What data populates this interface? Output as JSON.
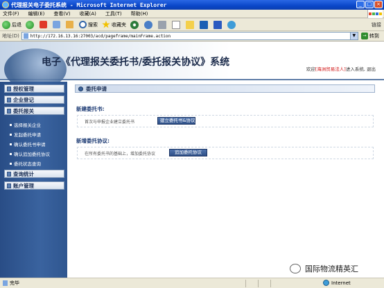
{
  "window": {
    "title": "代理报关电子委托系统 - Microsoft Internet Explorer",
    "min": "_",
    "max": "□",
    "close": "×"
  },
  "menu": [
    "文件(F)",
    "编辑(E)",
    "查看(V)",
    "收藏(A)",
    "工具(T)",
    "帮助(H)"
  ],
  "toolbar": {
    "back": "后退",
    "search": "搜索",
    "favorites": "收藏夹",
    "links": "链接"
  },
  "address": {
    "label": "地址(D)",
    "url": "http://172.16.13.16:27003/acd/pageframe/mainFrame.action",
    "go": "转到"
  },
  "header": {
    "site_title": "电子《代理报关委托书/委托报关协议》系统",
    "welcome": "欢迎",
    "user": "[海洲贸易法人]",
    "entered": "进入系统,",
    "logout": "退出"
  },
  "sidebar": {
    "sections": [
      {
        "label": "授权管理"
      },
      {
        "label": "企业登记"
      },
      {
        "label": "委托报关"
      }
    ],
    "sub_items": [
      "选择报关企业",
      "发起委托申请",
      "确认委托书申请",
      "确认追加委托协议",
      "委托状态查询"
    ],
    "bottom_sections": [
      {
        "label": "查询统计"
      },
      {
        "label": "账户管理"
      }
    ]
  },
  "main": {
    "section_title": "委托申请",
    "new_power": {
      "heading": "新建委托书:",
      "desc": "首次与申报企业建立委托书",
      "button": "建立委托书&协议"
    },
    "new_agreement": {
      "heading": "新增委托协议:",
      "desc": "在所有委托书的基础上，增加委托协议",
      "button": "追加委托协议"
    }
  },
  "statusbar": {
    "done": "完毕",
    "zone": "Internet"
  },
  "watermark": {
    "text": "国际物流精英汇"
  }
}
